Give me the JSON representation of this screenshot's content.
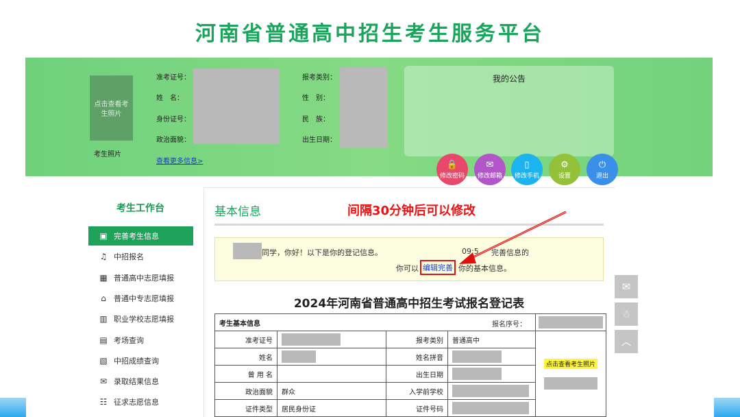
{
  "site_title": "河南省普通高中招生考生服务平台",
  "banner": {
    "photo_placeholder": "点击查看考生照片",
    "photo_caption": "考生照片",
    "labels": {
      "exam_no": "准考证号：",
      "name": "姓　名：",
      "id_no": "身份证号：",
      "political": "政治面貌：",
      "exam_type": "报考类别：",
      "gender": "性　别：",
      "ethnicity": "民　族：",
      "birth": "出生日期："
    },
    "more_link": "查看更多信息>",
    "notice_title": "我的公告",
    "actions": [
      {
        "label": "修改密码",
        "icon": "lock-icon",
        "glyph": "🔒",
        "color": "#e8496a"
      },
      {
        "label": "修改邮箱",
        "icon": "mail-icon",
        "glyph": "✉",
        "color": "#b255c8"
      },
      {
        "label": "修改手机",
        "icon": "phone-icon",
        "glyph": "▯",
        "color": "#1cb4ee"
      },
      {
        "label": "设置",
        "icon": "gear-icon",
        "glyph": "⚙",
        "color": "#93c23a"
      },
      {
        "label": "退出",
        "icon": "power-icon",
        "glyph": "⏻",
        "color": "#3a8fe8"
      }
    ]
  },
  "sidebar": {
    "title": "考生工作台",
    "items": [
      {
        "label": "完善考生信息",
        "icon": "id-card-icon",
        "glyph": "▣",
        "active": true
      },
      {
        "label": "中招报名",
        "icon": "bell-icon",
        "glyph": "♫",
        "active": false
      },
      {
        "label": "普通高中志愿填报",
        "icon": "building-icon",
        "glyph": "▦",
        "active": false
      },
      {
        "label": "普通中专志愿填报",
        "icon": "bank-icon",
        "glyph": "⌂",
        "active": false
      },
      {
        "label": "职业学校志愿填报",
        "icon": "bar-chart-icon",
        "glyph": "▥",
        "active": false
      },
      {
        "label": "考场查询",
        "icon": "exam-room-icon",
        "glyph": "▤",
        "active": false
      },
      {
        "label": "中招成绩查询",
        "icon": "score-icon",
        "glyph": "▧",
        "active": false
      },
      {
        "label": "录取结果信息",
        "icon": "envelope-open-icon",
        "glyph": "✉",
        "active": false
      },
      {
        "label": "征求志愿信息",
        "icon": "form-add-icon",
        "glyph": "☷",
        "active": false
      }
    ]
  },
  "main": {
    "heading": "基本信息",
    "annotation": "间隔30分钟后可以修改",
    "greeting": "同学，你好！以下是你的登记信息。",
    "time_note": "09:5",
    "time_note_tail": "完善信息的",
    "edit_prefix": "你可以",
    "edit_link": "编辑完善",
    "edit_suffix": "你的基本信息。",
    "form_title": "2024年河南省普通高中招生考试报名登记表"
  },
  "table": {
    "section_label": "考生基本信息",
    "reg_no_label": "报名序号：",
    "rows": [
      {
        "l1": "准考证号",
        "v1": "",
        "l2": "报考类别",
        "v2": "普通高中"
      },
      {
        "l1": "姓名",
        "v1": "",
        "l2": "姓名拼音",
        "v2": ""
      },
      {
        "l1": "曾 用 名",
        "v1": "",
        "l2": "出生日期",
        "v2": ""
      },
      {
        "l1": "政治面貌",
        "v1": "群众",
        "l2": "入学前学校",
        "v2": ""
      },
      {
        "l1": "证件类型",
        "v1": "居民身份证",
        "l2": "证件号码",
        "v2": ""
      }
    ],
    "photo_tip": "点击查看考生照片"
  },
  "float_buttons": [
    {
      "icon": "wechat-icon",
      "glyph": "✉"
    },
    {
      "icon": "qq-icon",
      "glyph": "☃"
    },
    {
      "icon": "back-to-top-icon",
      "glyph": "︿"
    }
  ]
}
